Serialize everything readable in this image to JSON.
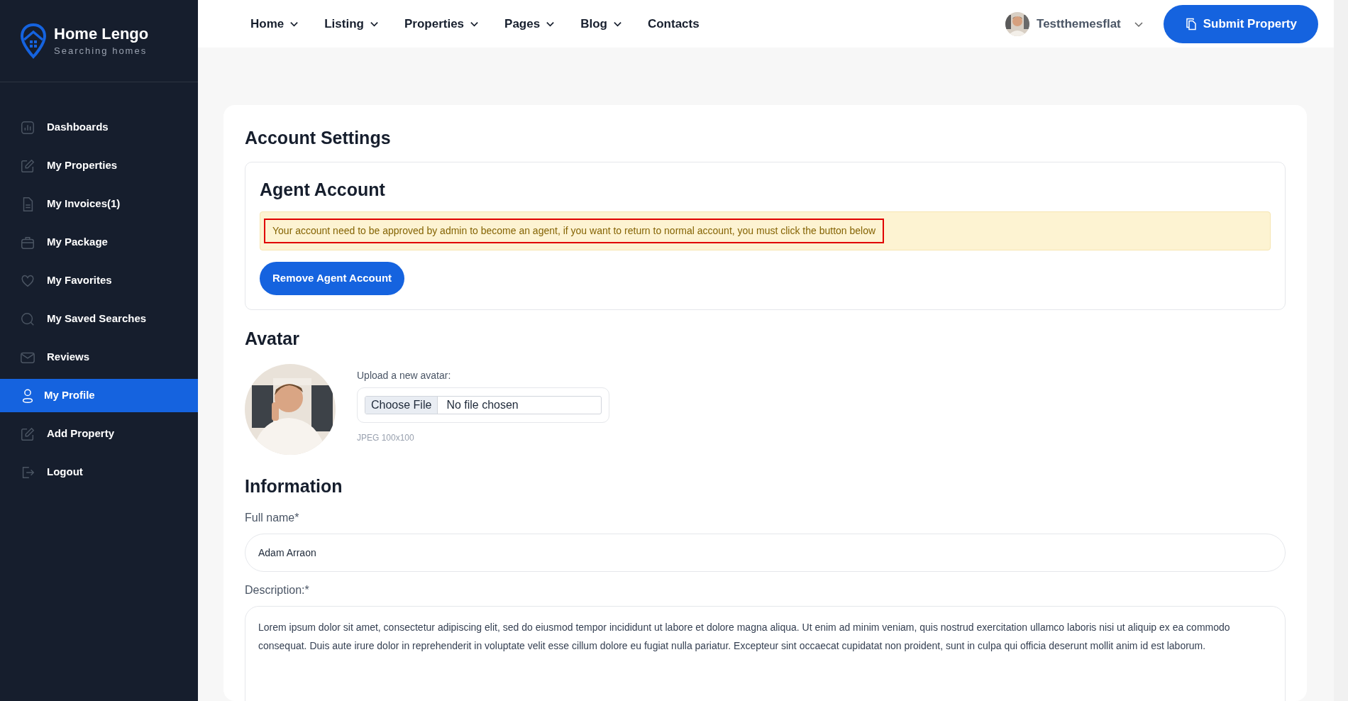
{
  "brand": {
    "name": "Home Lengo",
    "tagline": "Searching homes"
  },
  "sidebar": {
    "items": [
      {
        "label": "Dashboards",
        "selected": false
      },
      {
        "label": "My Properties",
        "selected": false
      },
      {
        "label": "My Invoices(1)",
        "selected": false
      },
      {
        "label": "My Package",
        "selected": false
      },
      {
        "label": "My Favorites",
        "selected": false
      },
      {
        "label": "My Saved Searches",
        "selected": false
      },
      {
        "label": "Reviews",
        "selected": false
      },
      {
        "label": "My Profile",
        "selected": true
      },
      {
        "label": "Add Property",
        "selected": false
      },
      {
        "label": "Logout",
        "selected": false
      }
    ]
  },
  "nav": {
    "items": [
      {
        "label": "Home",
        "dropdown": true
      },
      {
        "label": "Listing",
        "dropdown": true
      },
      {
        "label": "Properties",
        "dropdown": true
      },
      {
        "label": "Pages",
        "dropdown": true
      },
      {
        "label": "Blog",
        "dropdown": true
      },
      {
        "label": "Contacts",
        "dropdown": false
      }
    ],
    "user": "Testthemesflat",
    "submit_button": "Submit Property"
  },
  "page": {
    "title": "Account Settings",
    "agent": {
      "heading": "Agent Account",
      "alert": "Your account need to be approved by admin to become an agent, if you want to return to normal account, you must click the button below",
      "alert_highlighted": true,
      "button": "Remove Agent Account"
    },
    "avatar": {
      "heading": "Avatar",
      "upload_label": "Upload a new avatar:",
      "choose_button": "Choose File",
      "file_status": "No file chosen",
      "hint": "JPEG 100x100"
    },
    "information": {
      "heading": "Information",
      "fields": [
        {
          "label": "Full name*",
          "value": "Adam Arraon",
          "kind": "input"
        },
        {
          "label": "Description:*",
          "value": "Lorem ipsum dolor sit amet, consectetur adipiscing elit, sed do eiusmod tempor incididunt ut labore et dolore magna aliqua. Ut enim ad minim veniam, quis nostrud exercitation ullamco laboris nisi ut aliquip ex ea commodo consequat. Duis aute irure dolor in reprehenderit in voluptate velit esse cillum dolore eu fugiat nulla pariatur. Excepteur sint occaecat cupidatat non proident, sunt in culpa qui officia deserunt mollit anim id est laborum.",
          "kind": "textarea"
        }
      ]
    }
  }
}
